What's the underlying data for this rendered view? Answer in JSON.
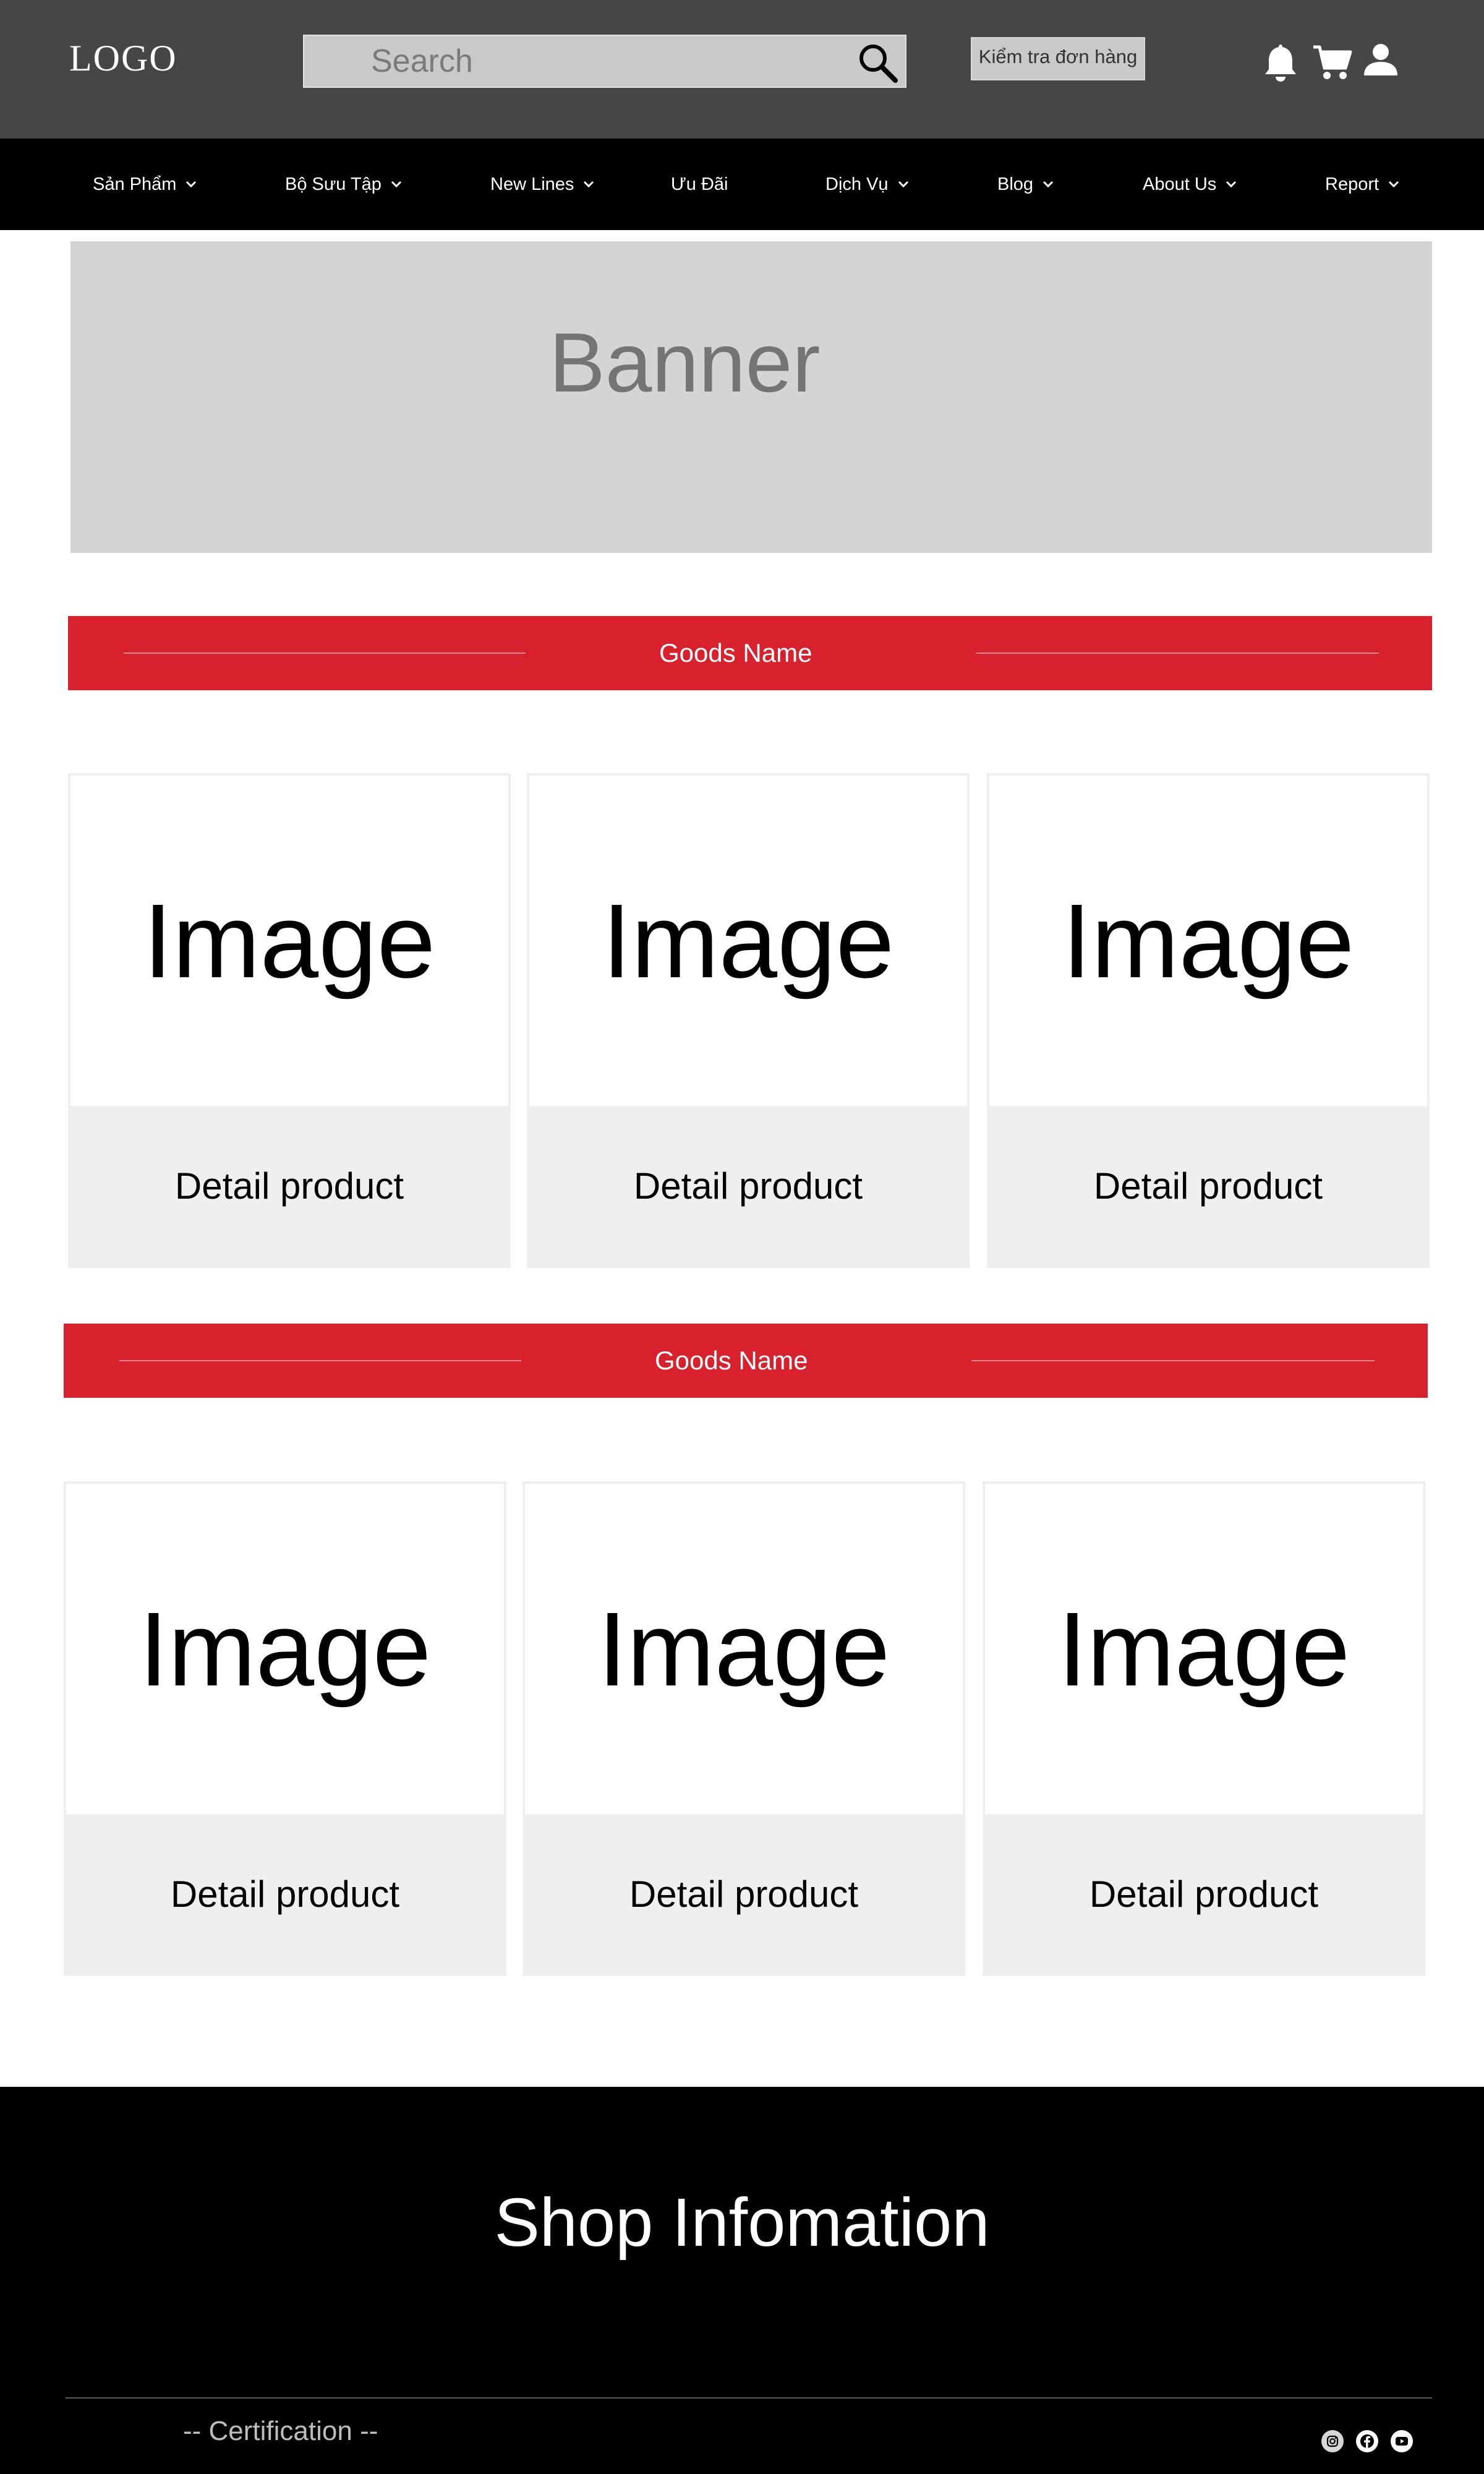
{
  "header": {
    "logo": "LOGO",
    "search_placeholder": "Search",
    "check_order_label": "Kiểm tra đơn hàng",
    "icons": [
      "search-icon",
      "bell-icon",
      "cart-icon",
      "user-icon"
    ]
  },
  "nav": {
    "items": [
      {
        "label": "Sản Phẩm",
        "has_dropdown": true
      },
      {
        "label": "Bộ Sưu Tập",
        "has_dropdown": true
      },
      {
        "label": "New Lines",
        "has_dropdown": true
      },
      {
        "label": "Ưu Đãi",
        "has_dropdown": false
      },
      {
        "label": "Dịch Vụ",
        "has_dropdown": true
      },
      {
        "label": "Blog",
        "has_dropdown": true
      },
      {
        "label": "About Us",
        "has_dropdown": true
      },
      {
        "label": "Report",
        "has_dropdown": true
      }
    ]
  },
  "banner": {
    "label": "Banner"
  },
  "sections": [
    {
      "title": "Goods Name",
      "products": [
        {
          "image_label": "Image",
          "detail_label": "Detail product"
        },
        {
          "image_label": "Image",
          "detail_label": "Detail product"
        },
        {
          "image_label": "Image",
          "detail_label": "Detail product"
        }
      ]
    },
    {
      "title": "Goods Name",
      "products": [
        {
          "image_label": "Image",
          "detail_label": "Detail product"
        },
        {
          "image_label": "Image",
          "detail_label": "Detail product"
        },
        {
          "image_label": "Image",
          "detail_label": "Detail product"
        }
      ]
    }
  ],
  "footer": {
    "shop_info": "Shop Infomation",
    "certification": "-- Certification --",
    "social_icons": [
      "instagram-icon",
      "facebook-icon",
      "youtube-icon"
    ]
  },
  "colors": {
    "header_bg": "#464647",
    "nav_bg": "#000000",
    "accent_red": "#d9212d",
    "banner_bg": "#d4d4d4",
    "detail_bg": "#efefef",
    "footer_bg": "#000000"
  }
}
